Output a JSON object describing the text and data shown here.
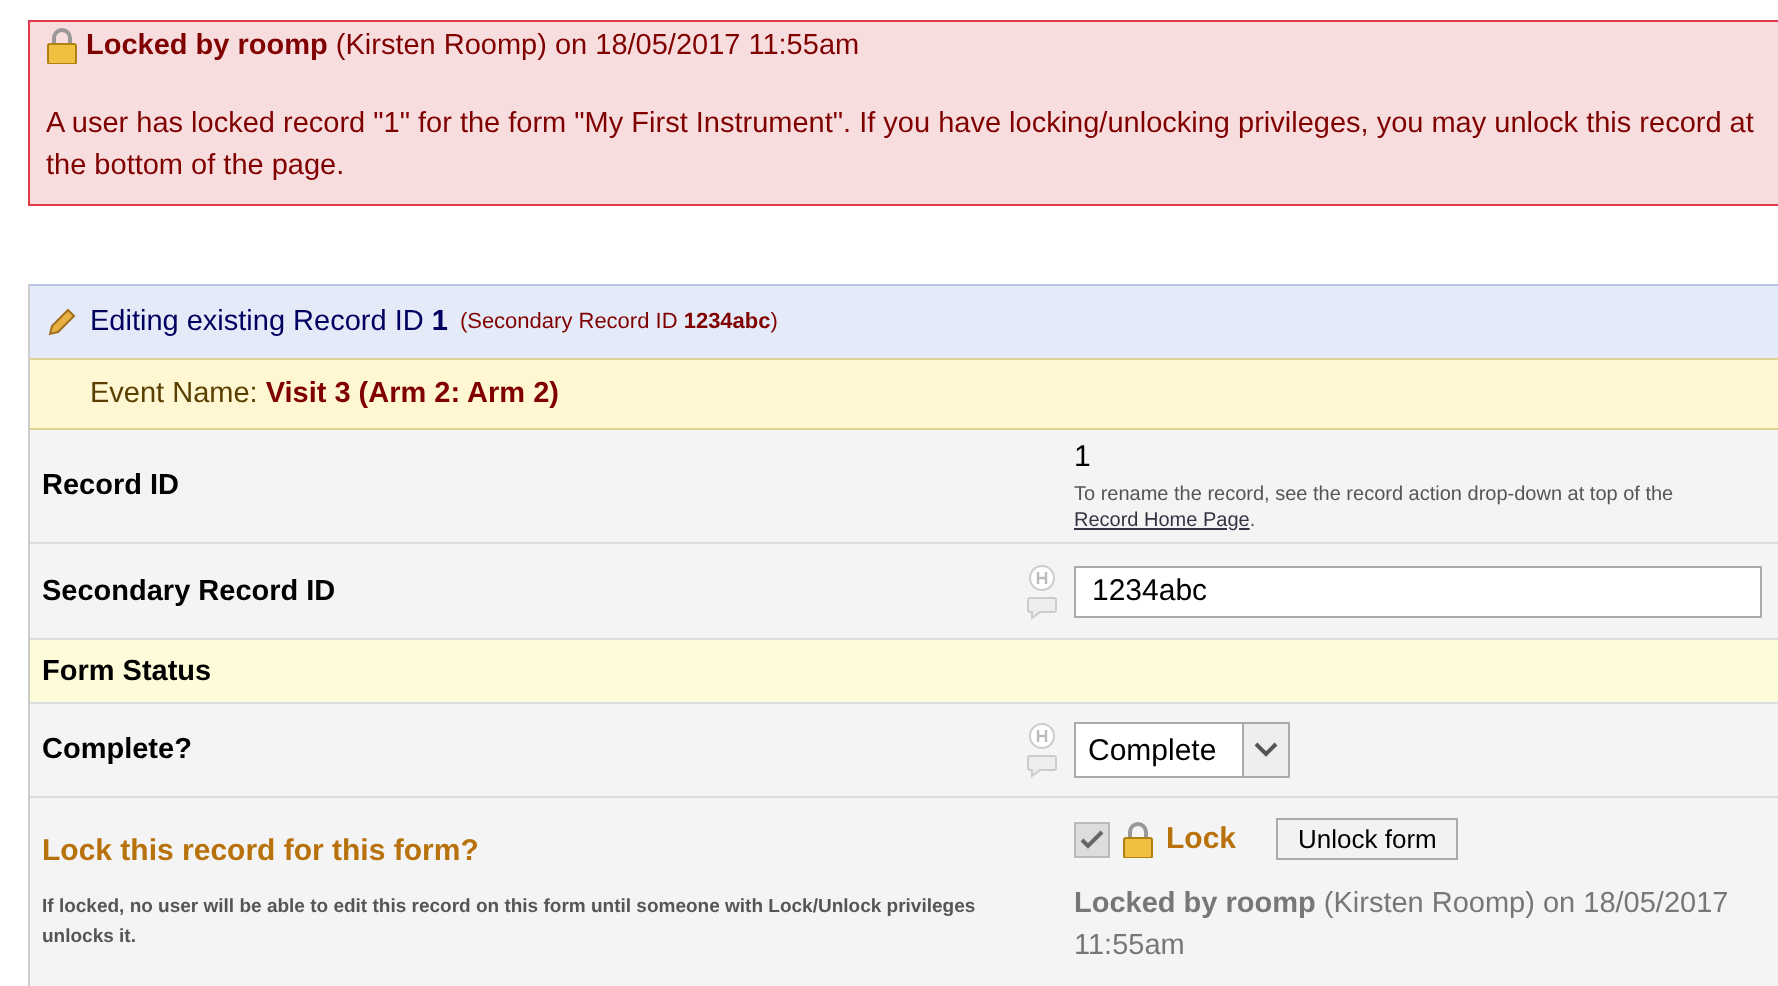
{
  "alert": {
    "title": "**Locked by roomp** (Kirsten Roomp) on 18/05/2017 11:55am",
    "message": "A user has locked record \"1\" for the form \"My First Instrument\". If you have locking/unlocking privileges, you may unlock this record at the bottom of the page."
  },
  "header": {
    "title": "Editing existing Record ID **1**",
    "secondary": "(Secondary Record ID **1234abc**)"
  },
  "event": {
    "label": "Event Name:",
    "value": "Visit 3 (Arm 2: Arm 2)"
  },
  "rows": [
    {
      "kind": "static",
      "label": "Record ID",
      "value": "1",
      "note": "To rename the record, see the record action drop-down at top of the",
      "link": "Record Home Page",
      "note_end": "."
    },
    {
      "kind": "text",
      "label": "Secondary Record ID",
      "value": "1234abc"
    },
    {
      "kind": "section",
      "label": "Form Status"
    },
    {
      "kind": "select",
      "label": "Complete?",
      "value": "Complete"
    },
    {
      "kind": "lock",
      "label": "Lock this record for this form?",
      "hint": "If locked, no user will be able to edit this record on this form until someone with Lock/Unlock privileges unlocks it.",
      "checked": true,
      "lock_label": "Lock",
      "button": "Unlock form",
      "status": "**Locked by roomp** (Kirsten Roomp) on 18/05/2017 11:55am"
    }
  ]
}
